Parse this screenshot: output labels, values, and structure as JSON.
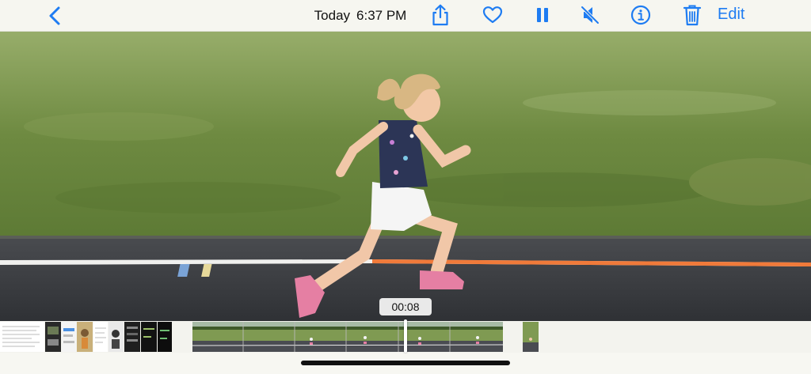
{
  "header": {
    "back_icon": "chevron-left-icon",
    "date_label": "Today",
    "time_label": "6:37 PM",
    "share_icon": "share-icon",
    "favorite_icon": "heart-icon",
    "pause_icon": "pause-icon",
    "mute_icon": "speaker-muted-icon",
    "info_icon": "info-icon",
    "delete_icon": "trash-icon",
    "edit_label": "Edit"
  },
  "player": {
    "timecode": "00:08",
    "scrubber_progress": 0.45
  },
  "colors": {
    "accent": "#1e7cf2",
    "grass": "#6f8a46",
    "track": "#3a3d42",
    "lane_line": "#f07a3a"
  }
}
